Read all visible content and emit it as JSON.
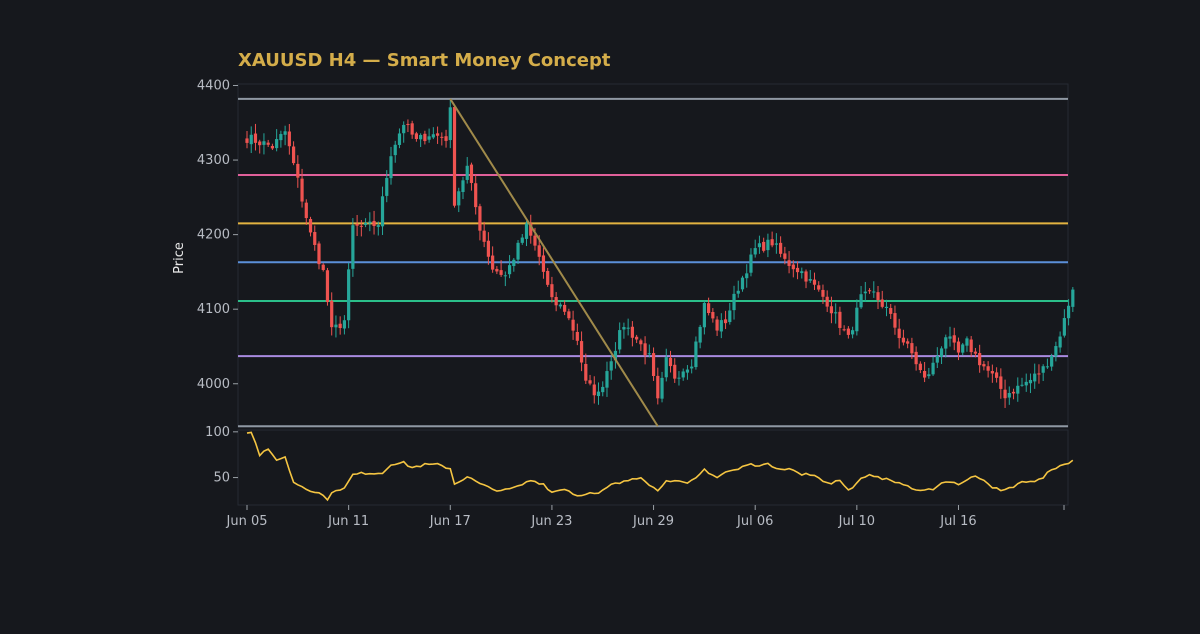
{
  "chart_data": {
    "type": "candlestick",
    "title": "XAUUSD H4 — Smart Money Concept",
    "ylabel": "Price",
    "ylim": [
      3942,
      4402
    ],
    "y_ticks": [
      4000,
      4100,
      4200,
      4300,
      4400
    ],
    "x_tick_labels": [
      "Jun 05",
      "Jun 11",
      "Jun 17",
      "Jun 23",
      "Jun 29",
      "Jul 06",
      "Jul 10",
      "Jul 16"
    ],
    "x_tick_bars": [
      0,
      24,
      48,
      72,
      96,
      120,
      144,
      168
    ],
    "bar_count": 196,
    "colors": {
      "up": "#26a69a",
      "down": "#ef5350",
      "title": "#d4ad4a",
      "rsi": "#f5c542",
      "trendline": "#a08a4a"
    },
    "levels": [
      {
        "price": 4382,
        "color": "#8f98a3"
      },
      {
        "price": 4280,
        "color": "#e0609a"
      },
      {
        "price": 4215,
        "color": "#e3b341"
      },
      {
        "price": 4163,
        "color": "#5b8fd9"
      },
      {
        "price": 4111,
        "color": "#2bbf8a"
      },
      {
        "price": 4037,
        "color": "#a98be0"
      },
      {
        "price": 3943,
        "color": "#8f98a3"
      }
    ],
    "trendline": {
      "from": {
        "bar": 48,
        "price": 4382
      },
      "to": {
        "bar": 97,
        "price": 3943
      }
    },
    "price_anchors": [
      [
        0,
        4330
      ],
      [
        6,
        4318
      ],
      [
        9,
        4338
      ],
      [
        12,
        4272
      ],
      [
        15,
        4200
      ],
      [
        18,
        4150
      ],
      [
        20,
        4070
      ],
      [
        23,
        4085
      ],
      [
        25,
        4210
      ],
      [
        28,
        4210
      ],
      [
        31,
        4215
      ],
      [
        34,
        4310
      ],
      [
        37,
        4350
      ],
      [
        40,
        4325
      ],
      [
        43,
        4335
      ],
      [
        47,
        4330
      ],
      [
        48,
        4365
      ],
      [
        49,
        4245
      ],
      [
        52,
        4290
      ],
      [
        55,
        4210
      ],
      [
        58,
        4155
      ],
      [
        61,
        4145
      ],
      [
        63,
        4170
      ],
      [
        66,
        4210
      ],
      [
        69,
        4170
      ],
      [
        72,
        4110
      ],
      [
        75,
        4100
      ],
      [
        78,
        4060
      ],
      [
        80,
        4000
      ],
      [
        83,
        3985
      ],
      [
        86,
        4035
      ],
      [
        89,
        4080
      ],
      [
        92,
        4060
      ],
      [
        95,
        4035
      ],
      [
        97,
        3975
      ],
      [
        99,
        4030
      ],
      [
        101,
        4010
      ],
      [
        105,
        4030
      ],
      [
        108,
        4105
      ],
      [
        111,
        4075
      ],
      [
        113,
        4085
      ],
      [
        116,
        4130
      ],
      [
        120,
        4180
      ],
      [
        124,
        4190
      ],
      [
        127,
        4165
      ],
      [
        131,
        4150
      ],
      [
        134,
        4130
      ],
      [
        137,
        4110
      ],
      [
        140,
        4080
      ],
      [
        142,
        4060
      ],
      [
        145,
        4115
      ],
      [
        148,
        4120
      ],
      [
        151,
        4100
      ],
      [
        154,
        4065
      ],
      [
        157,
        4040
      ],
      [
        160,
        4005
      ],
      [
        162,
        4025
      ],
      [
        165,
        4065
      ],
      [
        168,
        4040
      ],
      [
        170,
        4055
      ],
      [
        173,
        4030
      ],
      [
        176,
        4010
      ],
      [
        179,
        3985
      ],
      [
        182,
        3995
      ],
      [
        185,
        4005
      ],
      [
        188,
        4020
      ],
      [
        191,
        4050
      ],
      [
        193,
        4085
      ],
      [
        195,
        4130
      ]
    ],
    "rsi_panel": {
      "y_ticks": [
        50,
        100
      ],
      "ylim": [
        20,
        102
      ],
      "anchors": [
        [
          0,
          100
        ],
        [
          1,
          100
        ],
        [
          3,
          75
        ],
        [
          5,
          80
        ],
        [
          7,
          70
        ],
        [
          9,
          72
        ],
        [
          11,
          45
        ],
        [
          14,
          38
        ],
        [
          17,
          33
        ],
        [
          19,
          27
        ],
        [
          21,
          37
        ],
        [
          23,
          38
        ],
        [
          25,
          53
        ],
        [
          28,
          55
        ],
        [
          32,
          55
        ],
        [
          34,
          65
        ],
        [
          37,
          66
        ],
        [
          39,
          61
        ],
        [
          42,
          64
        ],
        [
          45,
          64
        ],
        [
          48,
          60
        ],
        [
          49,
          43
        ],
        [
          52,
          51
        ],
        [
          55,
          43
        ],
        [
          58,
          37
        ],
        [
          61,
          36
        ],
        [
          64,
          40
        ],
        [
          67,
          47
        ],
        [
          70,
          43
        ],
        [
          72,
          34
        ],
        [
          75,
          38
        ],
        [
          78,
          30
        ],
        [
          80,
          33
        ],
        [
          83,
          32
        ],
        [
          86,
          42
        ],
        [
          89,
          45
        ],
        [
          91,
          49
        ],
        [
          93,
          51
        ],
        [
          95,
          43
        ],
        [
          97,
          35
        ],
        [
          99,
          48
        ],
        [
          101,
          46
        ],
        [
          104,
          43
        ],
        [
          106,
          49
        ],
        [
          108,
          59
        ],
        [
          111,
          50
        ],
        [
          113,
          56
        ],
        [
          116,
          59
        ],
        [
          118,
          64
        ],
        [
          120,
          64
        ],
        [
          123,
          64
        ],
        [
          126,
          60
        ],
        [
          128,
          60
        ],
        [
          131,
          53
        ],
        [
          133,
          54
        ],
        [
          136,
          46
        ],
        [
          138,
          44
        ],
        [
          140,
          48
        ],
        [
          142,
          36
        ],
        [
          144,
          44
        ],
        [
          146,
          52
        ],
        [
          148,
          52
        ],
        [
          151,
          48
        ],
        [
          154,
          44
        ],
        [
          156,
          41
        ],
        [
          158,
          35
        ],
        [
          160,
          35
        ],
        [
          162,
          38
        ],
        [
          164,
          44
        ],
        [
          166,
          46
        ],
        [
          168,
          43
        ],
        [
          170,
          47
        ],
        [
          172,
          52
        ],
        [
          174,
          48
        ],
        [
          176,
          40
        ],
        [
          178,
          35
        ],
        [
          180,
          38
        ],
        [
          182,
          43
        ],
        [
          184,
          46
        ],
        [
          186,
          46
        ],
        [
          188,
          49
        ],
        [
          190,
          60
        ],
        [
          192,
          62
        ],
        [
          194,
          65
        ],
        [
          195,
          70
        ]
      ]
    }
  }
}
